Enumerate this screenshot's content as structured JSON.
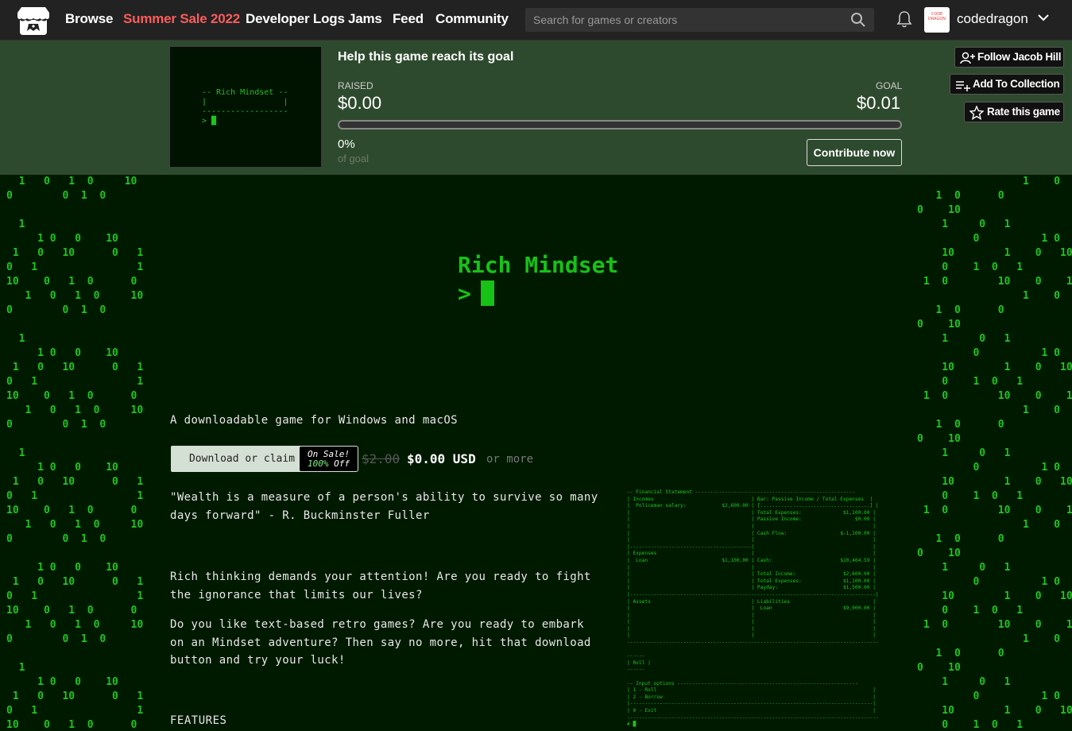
{
  "nav": {
    "links": [
      "Browse",
      "Summer Sale 2022",
      "Developer Logs",
      "Jams",
      "Feed",
      "Community"
    ],
    "search_placeholder": "Search for games or creators",
    "username": "codedragon",
    "avatar_text": "CODE DRAGON"
  },
  "goal": {
    "title": "Help this game reach its goal",
    "raised_label": "RAISED",
    "raised": "$0.00",
    "goal_label": "GOAL",
    "goal": "$0.01",
    "percent": "0%",
    "percent_value": 0,
    "of_goal": "of goal",
    "contribute": "Contribute now"
  },
  "side_buttons": {
    "follow": "Follow Jacob Hill",
    "collection": "Add To Collection",
    "rate": "Rate this game"
  },
  "thumbnail": {
    "lines": [
      "-- Rich Mindset --",
      "|                |",
      "------------------",
      "> █"
    ]
  },
  "hero": {
    "title": "Rich Mindset",
    "prompt": ">"
  },
  "game": {
    "platform_text": "A downloadable game for Windows and macOS",
    "download_button": "Download or claim",
    "sale_line1": "On Sale!",
    "sale_pct": "100%",
    "sale_off": "Off",
    "old_price": "$2.00",
    "new_price": "$0.00 USD",
    "or_more": "or more",
    "quote": "\"Wealth is a measure of a person's ability to survive so many days forward\" - R. Buckminster Fuller",
    "para1": "Rich thinking demands your attention! Are you ready to fight the ignorance that limits our lives?",
    "para2": "Do you like text-based retro games? Are you ready to embark on an Mindset adventure?  Then say no more, hit that download button and try your luck!",
    "features_heading": "FEATURES"
  },
  "screenshot": {
    "lines": [
      "-- Financial Statement ------------------------------------------------------",
      "| Incomes                                 | Bar: Passive Income / Total Expenses  |",
      "|  Policeman salary:            $2,600.00 | [.....................................] |",
      "|                                         | Total Expenses:              $1,100.00 |",
      "|                                         | Passive Income:                  $0.00 |",
      "|                                         |                                        |",
      "|                                         | Cash Flow:                  $-1,100.00 |",
      "|                                         |                                        |",
      "|-----------------------------------------|                                        |",
      "| Expenses                                |                                        |",
      "|  Loan                         $1,100.00 | Cash:                       $10,464.59 |",
      "|                                         |                                        |",
      "|                                         | Total Income:                $2,600.00 |",
      "|                                         | Total Expenses:              $1,100.00 |",
      "|                                         | Payday:                      $1,500.00 |",
      "|-----------------------------------------------------------------------------------|",
      "| Assets                                  | Liabilities                            |",
      "|                                         |  Loan                        $9,000.00 |",
      "|                                         |                                        |",
      "|                                         |                                        |",
      "|                                         |                                        |",
      "|                                         |                                        |",
      "-------------------------------------------------------------------------------------",
      "",
      "------",
      "| Roll |",
      "------",
      "",
      "-- Input options -------------------------------------------------------------",
      "| 1 - Roll                                                                         |",
      "| 2 - Borrow                                                                       |",
      "|----------------------------------------------------------------------------------|",
      "| 0 - Exit                                                                         |",
      "-------------------------------------------------------------------------------------",
      "# █"
    ]
  },
  "matrix": {
    "left": [
      "  1   0   1  0     10",
      "0        0  1  0",
      "",
      "  1",
      "     1 0   0    10",
      " 1   0   10      0   1",
      "0   1                1",
      "10    0   1  0      0",
      "   1   0   1  0     10",
      "0        0  1  0",
      "",
      "  1",
      "     1 0   0    10",
      " 1   0   10      0   1",
      "0   1                1",
      "10    0   1  0      0",
      "   1   0   1  0     10",
      "0        0  1  0",
      "",
      "  1",
      "     1 0   0    10",
      " 1   0   10      0   1",
      "0   1                1",
      "10    0   1  0      0",
      "   1   0   1  0     10",
      "0        0  1  0",
      "",
      "     1 0   0    10",
      " 1   0   10      0   1",
      "0   1                1",
      "10    0   1  0      0",
      "   1   0   1  0     10",
      "0        0  1  0",
      "",
      "  1",
      "     1 0   0    10",
      " 1   0   10      0   1",
      "0   1                1",
      "10    0   1  0      0"
    ],
    "right": [
      "                 1    0    1",
      "   1  0      0            0",
      "0    10",
      "    1     0   1",
      "         0          1 0",
      "    10        1    0   10",
      "    0    1  0   1",
      " 1  0        10    0    1",
      "                 1    0    0",
      "   1  0      0            0",
      "0    10",
      "    1     0   1",
      "         0          1 0",
      "    10        1    0   10",
      "    0    1  0   1",
      " 1  0        10    0    1",
      "                 1    0    0",
      "   1  0      0            0",
      "0    10",
      "    1     0   1",
      "         0          1 0",
      "    10        1    0   10",
      "    0    1  0   1",
      " 1  0        10    0    1",
      "                 1    0    0",
      "   1  0      0            0",
      "0    10",
      "    1     0   1",
      "         0          1 0",
      "    10        1    0   10",
      "    0    1  0   1",
      " 1  0        10    0    1",
      "                 1    0    0",
      "   1  0      0            0",
      "0    10",
      "    1     0   1",
      "         0          1 0",
      "    10        1    0   10",
      "    0    1  0   1",
      " 1  0        10    0    1"
    ]
  }
}
